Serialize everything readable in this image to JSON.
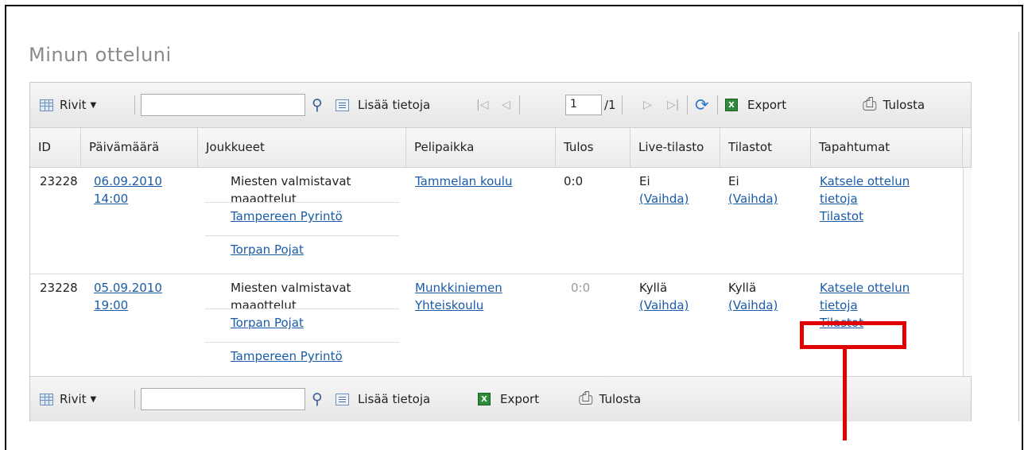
{
  "page": {
    "title": "Minun otteluni"
  },
  "toolbar": {
    "rows_label": "Rivit",
    "search_value": "",
    "more_info_label": "Lisää tietoja",
    "page_current": "1",
    "page_total": "/1",
    "export_label": "Export",
    "print_label": "Tulosta"
  },
  "bottom_toolbar": {
    "rows_label": "Rivit",
    "search_value": "",
    "more_info_label": "Lisää tietoja",
    "export_label": "Export",
    "print_label": "Tulosta"
  },
  "columns": [
    "ID",
    "Päivämäärä",
    "Joukkueet",
    "Pelipaikka",
    "Tulos",
    "Live-tilasto",
    "Tilastot",
    "Tapahtumat"
  ],
  "rows": [
    {
      "id": "23228",
      "date": "06.09.2010",
      "time": "14:00",
      "series_line1": "Miesten valmistavat",
      "series_line2": "maaottelut",
      "team1": "Tampereen Pyrintö",
      "team2": "Torpan Pojat",
      "venue_line1": "Tammelan koulu",
      "venue_line2": "",
      "score": "0:0",
      "live": "Ei",
      "live_change": "(Vaihda)",
      "stats": "Ei",
      "stats_change": "(Vaihda)",
      "event_view_line1": "Katsele ottelun",
      "event_view_line2": "tietoja",
      "event_stats": "Tilastot"
    },
    {
      "id": "23228",
      "date": "05.09.2010",
      "time": "19:00",
      "series_line1": "Miesten valmistavat",
      "series_line2": "maaottelut",
      "team1": "Torpan Pojat",
      "team2": "Tampereen Pyrintö",
      "venue_line1": "Munkkiniemen",
      "venue_line2": "Yhteiskoulu",
      "score": "0:0",
      "live": "Kyllä",
      "live_change": "(Vaihda)",
      "stats": "Kyllä",
      "stats_change": "(Vaihda)",
      "event_view_line1": "Katsele ottelun",
      "event_view_line2": "tietoja",
      "event_stats": "Tilastot"
    }
  ],
  "colors": {
    "link": "#1a5ca8",
    "highlight": "#e00000"
  }
}
